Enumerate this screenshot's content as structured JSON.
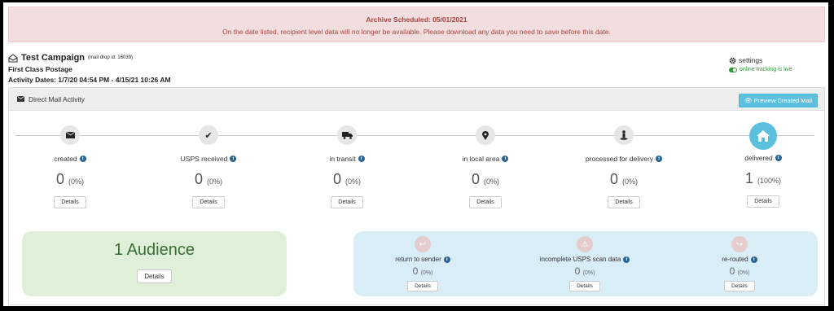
{
  "alert": {
    "title": "Archive Scheduled: 05/01/2021",
    "message": "On the date listed, recipient level data will no longer be available. Please download any data you need to save before this date."
  },
  "campaign": {
    "icon": "envelope-open-icon",
    "name": "Test Campaign",
    "mail_drop": "(mail drop id: 16039)",
    "postage": "First Class Postage",
    "activity_dates": "Activity Dates: 1/7/20 04:54 PM - 4/15/21 10:26 AM"
  },
  "settings": {
    "label": "settings",
    "tracking": "online tracking is live"
  },
  "panel": {
    "title": "Direct Mail Activity",
    "preview_button": "Preview Created Mail"
  },
  "steps": [
    {
      "label": "created",
      "count": "0",
      "pct": "(0%)",
      "button": "Details",
      "icon": "envelope-icon"
    },
    {
      "label": "USPS received",
      "count": "0",
      "pct": "(0%)",
      "button": "Details",
      "icon": "checkmark-icon"
    },
    {
      "label": "in transit",
      "count": "0",
      "pct": "(0%)",
      "button": "Details",
      "icon": "truck-icon"
    },
    {
      "label": "in local area",
      "count": "0",
      "pct": "(0%)",
      "button": "Details",
      "icon": "map-pin-icon"
    },
    {
      "label": "processed for delivery",
      "count": "0",
      "pct": "(0%)",
      "button": "Details",
      "icon": "person-pin-icon"
    },
    {
      "label": "delivered",
      "count": "1",
      "pct": "(100%)",
      "button": "Details",
      "icon": "home-icon"
    }
  ],
  "audience": {
    "label": "1 Audience",
    "button": "Details"
  },
  "misc": [
    {
      "label": "return to sender",
      "count": "0",
      "pct": "(0%)",
      "button": "Details",
      "icon": "reply-icon"
    },
    {
      "label": "incomplete USPS scan data",
      "count": "0",
      "pct": "(0%)",
      "button": "Details",
      "icon": "warning-icon"
    },
    {
      "label": "re-routed",
      "count": "0",
      "pct": "(0%)",
      "button": "Details",
      "icon": "forward-icon"
    }
  ],
  "colors": {
    "alert_bg": "#f2dede",
    "alert_text": "#a94442",
    "info_blue": "#5bc0de",
    "success_green": "#dff0d8",
    "light_blue": "#d9edf7"
  }
}
